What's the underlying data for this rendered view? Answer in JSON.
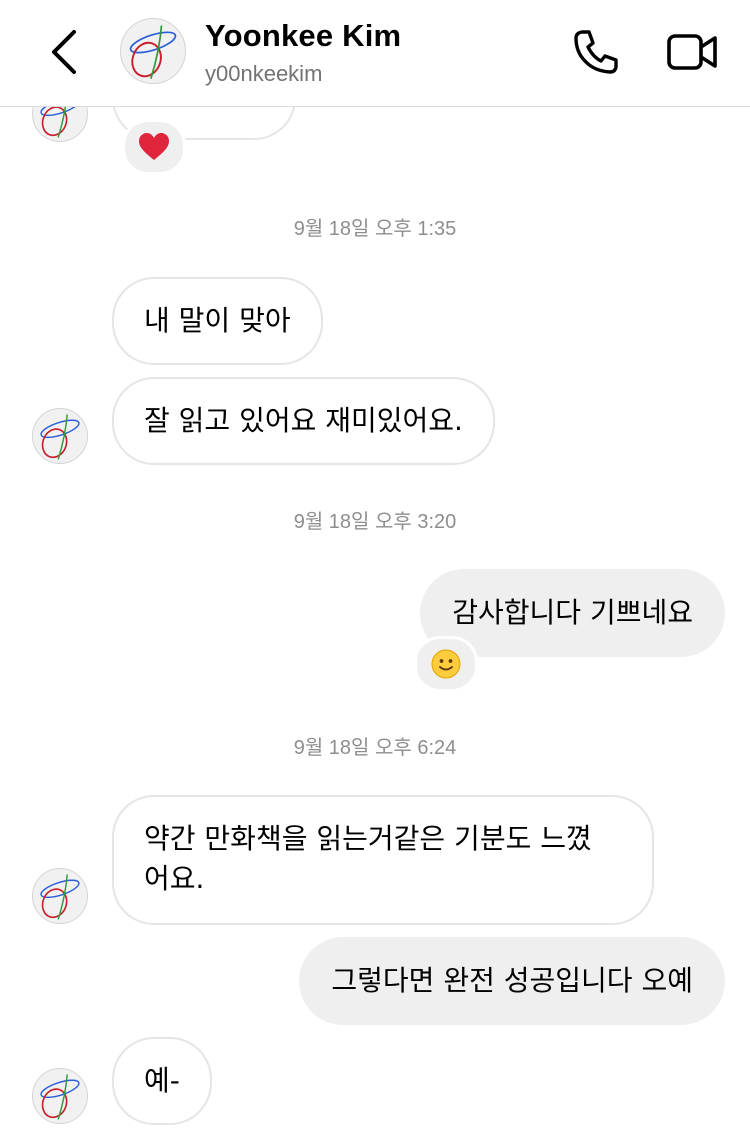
{
  "header": {
    "name": "Yoonkee Kim",
    "username": "y00nkeekim",
    "icons": {
      "back": "chevron-left-icon",
      "call": "phone-icon",
      "video": "video-camera-icon"
    }
  },
  "timestamps": [
    "9월 18일 오후 1:35",
    "9월 18일 오후 3:20",
    "9월 18일 오후 6:24"
  ],
  "messages": [
    {
      "from": "them",
      "text": "",
      "reaction": "heart"
    },
    {
      "from": "them",
      "text": "내 말이 맞아"
    },
    {
      "from": "them",
      "text": "잘 읽고 있어요 재미있어요."
    },
    {
      "from": "me",
      "text": "감사합니다 기쁘네요",
      "reaction": "smile"
    },
    {
      "from": "them",
      "line1": "약간 만화책을 읽는거같은 기분도 느꼈",
      "line2": "어요."
    },
    {
      "from": "me",
      "text": "그렇다면 완전 성공입니다 오예"
    },
    {
      "from": "them",
      "text": "예-"
    }
  ],
  "colors": {
    "incoming_border": "#e5e5e5",
    "outgoing_bg": "#efefef",
    "timestamp": "#8e8e8e",
    "heart": "#e0243c"
  }
}
